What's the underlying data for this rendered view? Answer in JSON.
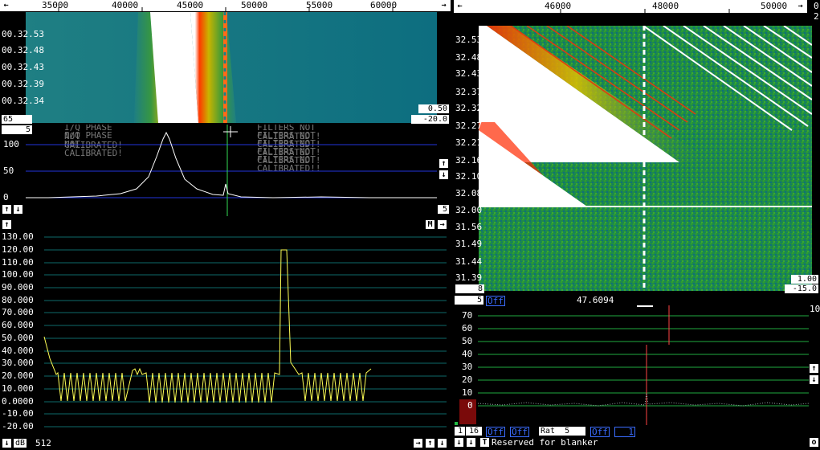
{
  "wide_graph": {
    "freq_ticks": [
      "35000",
      "40000",
      "45000",
      "50000",
      "55000",
      "60000"
    ],
    "time_labels": [
      "00.32.53",
      "00.32.48",
      "00.32.43",
      "00.32.39",
      "00.32.34"
    ],
    "gain_box": "0.50",
    "zero_box": "-20.0",
    "avgn_box": "65"
  },
  "spectrum": {
    "avgn_box": "5",
    "yticks": [
      "100",
      "50",
      "0"
    ],
    "messages": [
      "I/Q PHASE NOT CALIBRATED!",
      "I/Q PHASE NOT CALIBRATED!",
      "FILTERS NOT CALIBRATED!!",
      "FILTERS NOT CALIBRATED!!",
      "FILTERS NOT CALIBRATED!!",
      "FILTERS NOT CALIBRATED!!",
      "FILTERS NOT CALIBRATED!!"
    ],
    "right_box": "5"
  },
  "baseband": {
    "yticks": [
      "130.00",
      "120.00",
      "110.00",
      "100.00",
      "90.000",
      "80.000",
      "70.000",
      "60.000",
      "50.000",
      "40.000",
      "30.000",
      "20.000",
      "10.000",
      "0.0000",
      "-10.00",
      "-20.00"
    ],
    "m_label": "M",
    "db_label": "dB",
    "fft_size": "512"
  },
  "hires_graph": {
    "freq_ticks": [
      "46000",
      "48000",
      "50000"
    ],
    "time_labels": [
      "32.53",
      "32.48",
      "32.43",
      "32.37",
      "32.32",
      "32.27",
      "32.21",
      "32.16",
      "32.10",
      "32.08",
      "32.00",
      "31.56",
      "31.49",
      "31.44",
      "31.39"
    ],
    "corner_top": "0",
    "corner_bot": "2",
    "gain_box": "1.00",
    "zero_box": "-15.0",
    "avgn_box": "8"
  },
  "coherent": {
    "box_left": "5",
    "off_label": "Off",
    "freq_readout": "47.6094",
    "yticks": [
      "70",
      "60",
      "50",
      "40",
      "30",
      "20",
      "10",
      "0"
    ],
    "top_right": "10",
    "bottom_buttons": [
      "1",
      "16"
    ],
    "off1": "Off",
    "off2": "Off",
    "rat_label": "Rat",
    "rat_value": "5",
    "off3": "Off",
    "n_value": "1",
    "t_label": "T",
    "status": "Reserved for blanker",
    "corner": "o"
  },
  "colors": {
    "grid_blue": "#2233dd",
    "grid_green": "#1faa3f",
    "trace_yellow": "#ffff55",
    "trace_white": "#ffffff"
  }
}
